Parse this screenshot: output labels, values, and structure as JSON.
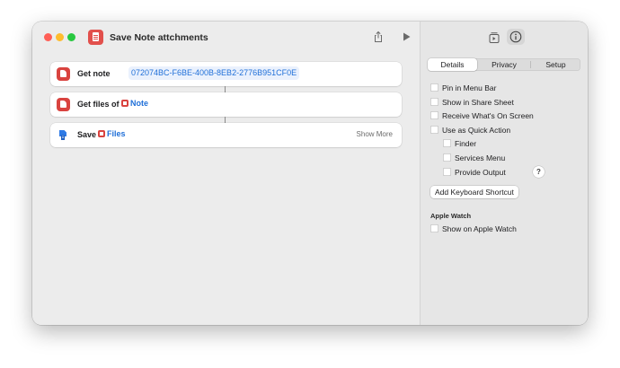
{
  "window": {
    "title": "Save Note attchments"
  },
  "actions": [
    {
      "verb": "Get note",
      "param": "072074BC-F6BE-400B-8EB2-2776B951CF0E",
      "icon": "notes-app-icon"
    },
    {
      "verb": "Get files of",
      "param": "Note",
      "icon": "notes-app-icon"
    },
    {
      "verb": "Save",
      "param": "Files",
      "icon": "files-app-icon",
      "extra": "Show More"
    }
  ],
  "inspector": {
    "tabs": [
      "Details",
      "Privacy",
      "Setup"
    ],
    "active_tab": "Details",
    "options": [
      "Pin in Menu Bar",
      "Show in Share Sheet",
      "Receive What's On Screen",
      "Use as Quick Action"
    ],
    "quick_action_options": [
      "Finder",
      "Services Menu",
      "Provide Output"
    ],
    "help_label": "?",
    "shortcut_button": "Add Keyboard Shortcut",
    "apple_watch_title": "Apple Watch",
    "apple_watch_option": "Show on Apple Watch"
  },
  "colors": {
    "accent": "#1f6fd8",
    "notes_red": "#d9433f",
    "close": "#ff5f57",
    "minimize": "#febc2e",
    "maximize": "#28c840"
  }
}
